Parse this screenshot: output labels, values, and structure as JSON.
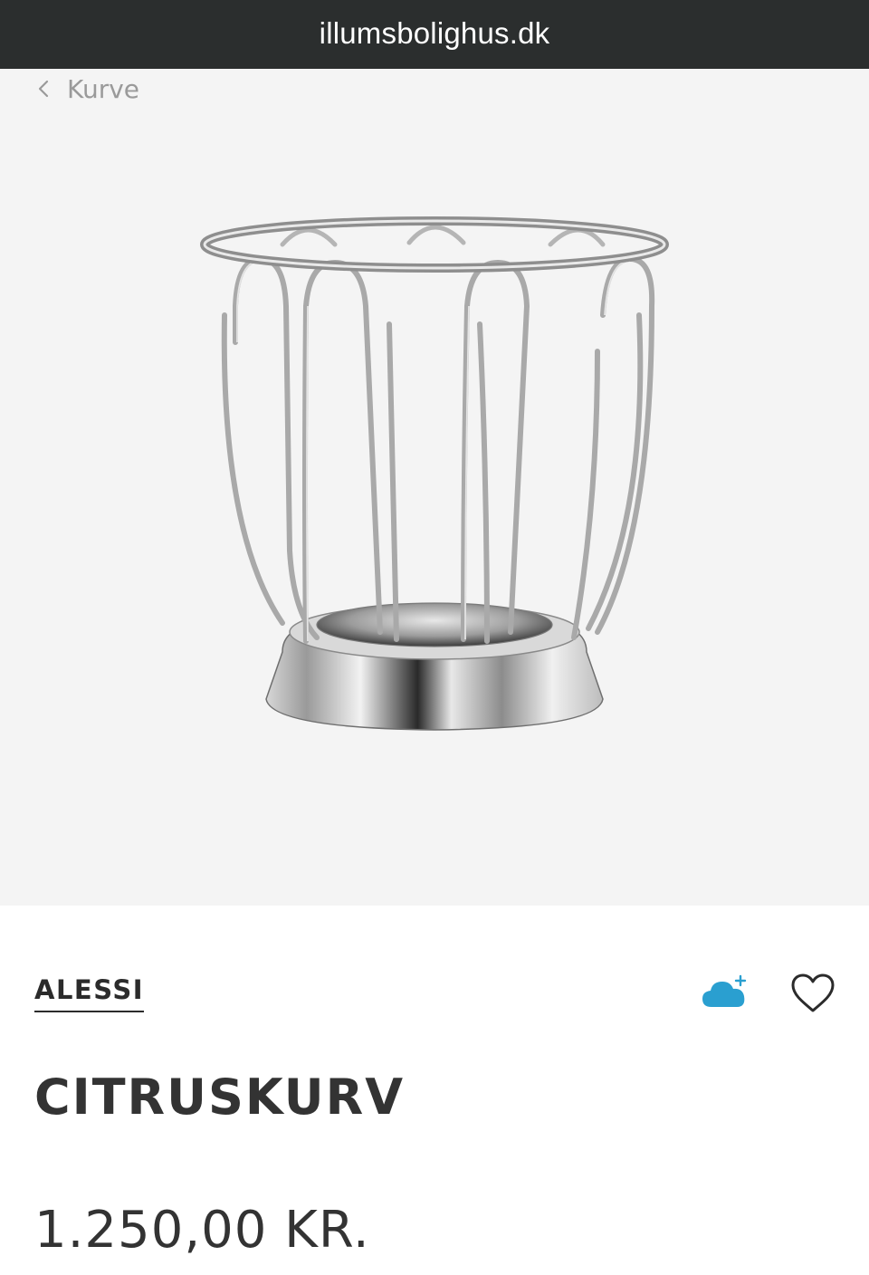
{
  "browser": {
    "url": "illumsbolighus.dk"
  },
  "nav": {
    "back_label": "Kurve"
  },
  "product": {
    "brand": "ALESSI",
    "name": "CITRUSKURV",
    "price": "1.250,00 KR.",
    "image_icon": "wire-basket-product-image"
  },
  "actions": {
    "cloud_icon": "cloud-add-icon",
    "heart_icon": "heart-outline-icon"
  },
  "colors": {
    "url_bar_bg": "#2b2e2e",
    "hero_bg": "#f4f4f4",
    "text_dark": "#333333",
    "back_text": "#9a9a9a",
    "cloud_blue": "#2a9fd0"
  }
}
